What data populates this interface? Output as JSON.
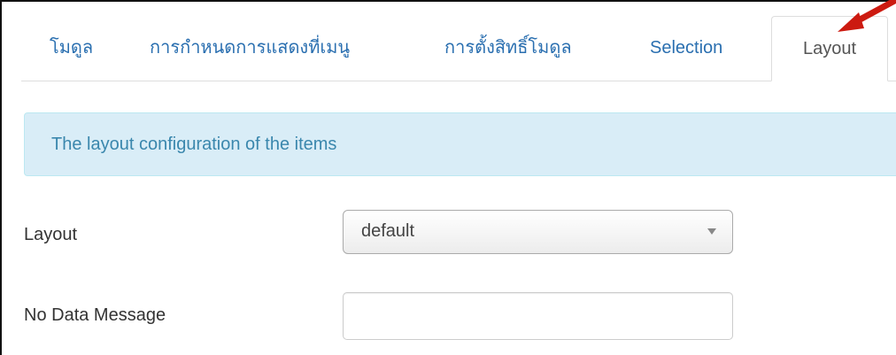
{
  "tabs": [
    {
      "label": "โมดูล",
      "active": false
    },
    {
      "label": "การกำหนดการแสดงที่เมนู",
      "active": false
    },
    {
      "label": "การตั้งสิทธิ์โมดูล",
      "active": false
    },
    {
      "label": "Selection",
      "active": false
    },
    {
      "label": "Layout",
      "active": true
    },
    {
      "label": "",
      "active": false
    }
  ],
  "alert": {
    "text": "The layout configuration of the items"
  },
  "form": {
    "layout": {
      "label": "Layout",
      "value": "default"
    },
    "no_data_message": {
      "label": "No Data Message",
      "value": "",
      "placeholder": ""
    }
  },
  "colors": {
    "tab_link": "#2a6fb0",
    "alert_bg": "#d9edf7",
    "alert_text": "#3a87ad",
    "annotation_arrow": "#cc1a10"
  },
  "icons": {
    "select_caret": "chevron-down-icon",
    "annotation": "red-arrow-icon"
  }
}
